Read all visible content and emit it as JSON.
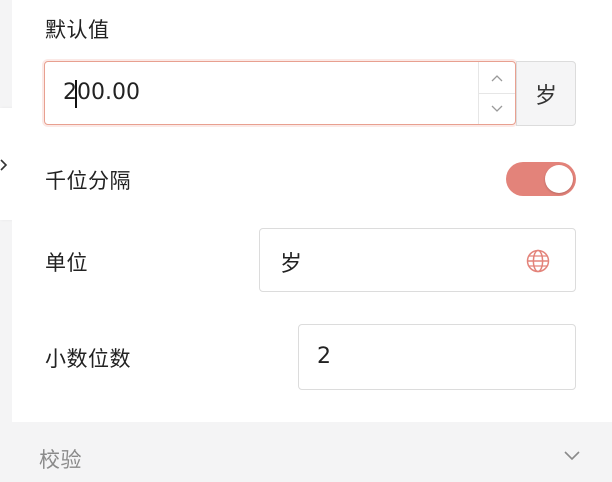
{
  "fields": {
    "default_value": {
      "label": "默认值",
      "value": "200.00",
      "unit_addon": "岁"
    },
    "thousand_separator": {
      "label": "千位分隔",
      "enabled": true
    },
    "unit": {
      "label": "单位",
      "value": "岁"
    },
    "decimal_places": {
      "label": "小数位数",
      "value": "2"
    }
  },
  "sections": {
    "validation": {
      "title": "校验",
      "expanded": false
    }
  },
  "colors": {
    "accent": "#e3837a",
    "focus_border": "#e8a090"
  },
  "icons": {
    "spin_up": "chevron-up-icon",
    "spin_down": "chevron-down-icon",
    "unit_picker": "globe-icon",
    "section_toggle": "chevron-down-icon",
    "side_toggle": "chevron-right-icon"
  }
}
